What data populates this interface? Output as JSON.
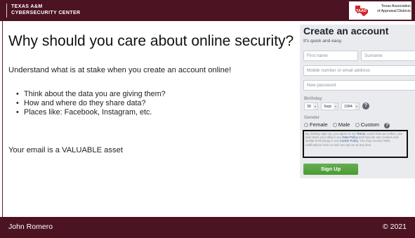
{
  "header": {
    "org_line1": "TEXAS A&M",
    "org_line2": "CYBERSECURITY CENTER",
    "partner_logo": "TAAD",
    "partner_line1": "Texas Association",
    "partner_line2": "of Appraisal Districts",
    "colors": {
      "bar": "#4c1322",
      "logo_red": "#d2232a"
    }
  },
  "slide": {
    "title": "Why should you care about online security?",
    "intro": "Understand what is at stake when you create an account online!",
    "bullets": [
      "Think about the data you are giving them?",
      "How and where do they share data?",
      "Places like: Facebook, Instagram, etc."
    ],
    "email_note": "Your email is a VALUABLE asset"
  },
  "signup_form": {
    "title": "Create an account",
    "subtitle": "It's quick and easy.",
    "first_name_placeholder": "First name",
    "surname_placeholder": "Surname",
    "mobile_placeholder": "Mobile number or email address",
    "password_placeholder": "New password",
    "birthday_label": "Birthday",
    "birthday_day": "30",
    "birthday_month": "Sept",
    "birthday_year": "1994",
    "help_icon": "?",
    "gender_label": "Gender",
    "gender_options": [
      "Female",
      "Male",
      "Custom"
    ],
    "terms_prefix": "By clicking Sign Up, you agree to our ",
    "terms_link": "Terms",
    "terms_mid1": ". Learn how we collect, use and share your data in our ",
    "data_policy_link": "Data Policy",
    "terms_mid2": " and how we use cookies and similar technology in our ",
    "cookie_policy_link": "Cookie Policy",
    "terms_suffix": ". You may receive SMS notifications from us and can opt out at any time.",
    "signup_button": "Sign Up",
    "colors": {
      "button": "#4f9b32",
      "link": "#385898"
    }
  },
  "footer": {
    "presenter": "John Romero",
    "copyright": "© 2021"
  }
}
